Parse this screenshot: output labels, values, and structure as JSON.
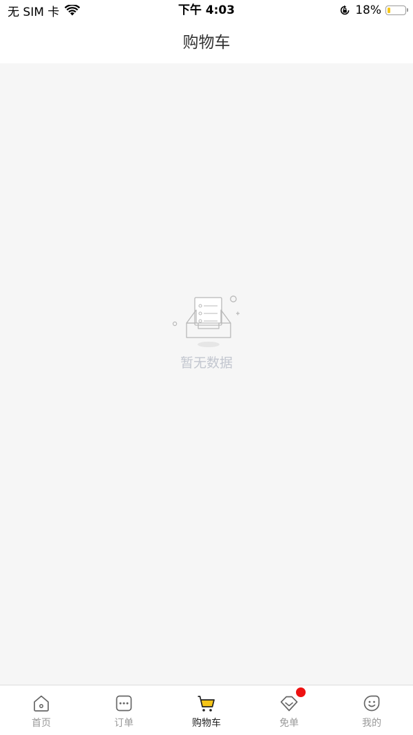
{
  "status_bar": {
    "carrier": "无 SIM 卡",
    "time": "下午 4:03",
    "battery_percent": "18%",
    "battery_level": 0.18,
    "icons": [
      "wifi-icon",
      "rotation-lock-icon",
      "battery-icon"
    ]
  },
  "nav": {
    "title": "购物车"
  },
  "empty_state": {
    "icon": "empty-box-icon",
    "text": "暂无数据"
  },
  "tabs": [
    {
      "label": "首页",
      "icon": "home-icon",
      "active": false
    },
    {
      "label": "订单",
      "icon": "order-icon",
      "active": false
    },
    {
      "label": "购物车",
      "icon": "cart-icon",
      "active": true
    },
    {
      "label": "免单",
      "icon": "diamond-icon",
      "active": false,
      "badge": true
    },
    {
      "label": "我的",
      "icon": "profile-icon",
      "active": false
    }
  ],
  "colors": {
    "accent": "#f5c518",
    "badge": "#ee1111",
    "content_bg": "#f6f6f6",
    "inactive_tab": "#999999",
    "active_tab": "#222222",
    "empty_text": "#c2c6cf"
  }
}
